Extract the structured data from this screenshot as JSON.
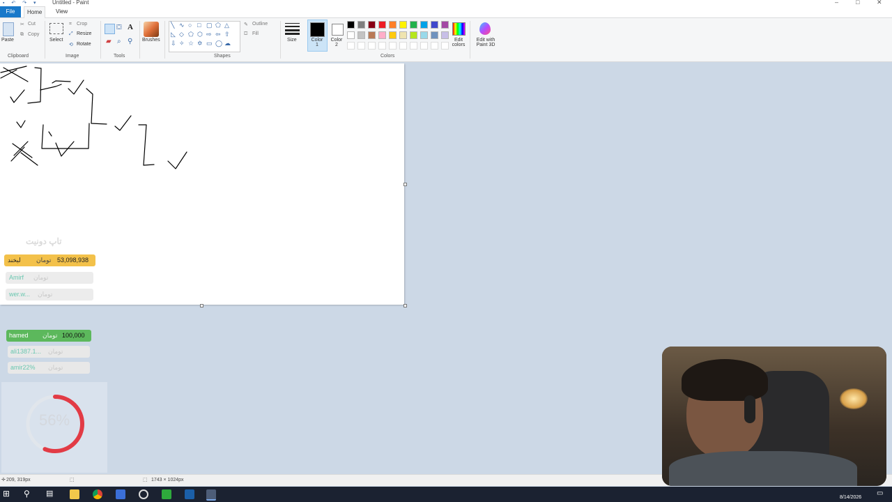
{
  "window": {
    "title": "Untitled - Paint"
  },
  "tabs": {
    "file": "File",
    "home": "Home",
    "view": "View"
  },
  "clipboard": {
    "paste": "Paste",
    "cut": "Cut",
    "copy": "Copy",
    "label": "Clipboard"
  },
  "image": {
    "select": "Select",
    "crop": "Crop",
    "resize": "Resize",
    "rotate": "Rotate",
    "label": "Image"
  },
  "tools": {
    "label": "Tools"
  },
  "brushes": {
    "label": "Brushes"
  },
  "shapes": {
    "outline": "Outline",
    "fill": "Fill",
    "label": "Shapes"
  },
  "size": {
    "label": "Size"
  },
  "colors": {
    "color1": "Color 1",
    "color2": "Color 2",
    "edit": "Edit colors",
    "label": "Colors",
    "color1_value": "#000000",
    "color2_value": "#ffffff",
    "palette_row1": [
      "#000000",
      "#7f7f7f",
      "#880015",
      "#ed1c24",
      "#ff7f27",
      "#fff200",
      "#22b14c",
      "#00a2e8",
      "#3f48cc",
      "#a349a4"
    ],
    "palette_row2": [
      "#ffffff",
      "#c3c3c3",
      "#b97a57",
      "#ffaec9",
      "#ffc90e",
      "#efe4b0",
      "#b5e61d",
      "#99d9ea",
      "#7092be",
      "#c8bfe7"
    ]
  },
  "paint3d": {
    "label": "Edit with Paint 3D"
  },
  "overlay": {
    "header": "تاپ دونیت",
    "donations": [
      {
        "name": "لبخند",
        "amount": "53,098,938",
        "unit": "تومان",
        "color": "#f3c14a"
      },
      {
        "name": "Amirf",
        "amount": "",
        "unit": "تومان",
        "color": "#ececec"
      },
      {
        "name": "wer.w...",
        "amount": "",
        "unit": "تومان",
        "color": "#ececec"
      }
    ],
    "recent": [
      {
        "name": "hamed",
        "amount": "100,000",
        "unit": "تومان",
        "color": "#5cb85c"
      },
      {
        "name": "ali1387.1...",
        "amount": "",
        "unit": "تومان",
        "color": "#e8e8e8"
      },
      {
        "name": "amir22%",
        "amount": "",
        "unit": "تومان",
        "color": "#e8e8e8"
      }
    ],
    "progress": {
      "percent_text": "56%",
      "percent": 56,
      "color": "#e23b45"
    }
  },
  "status": {
    "cursor_pos": "209, 319px",
    "canvas_size": "1743 × 1024px"
  },
  "taskbar": {
    "date": "8/14/2026"
  }
}
